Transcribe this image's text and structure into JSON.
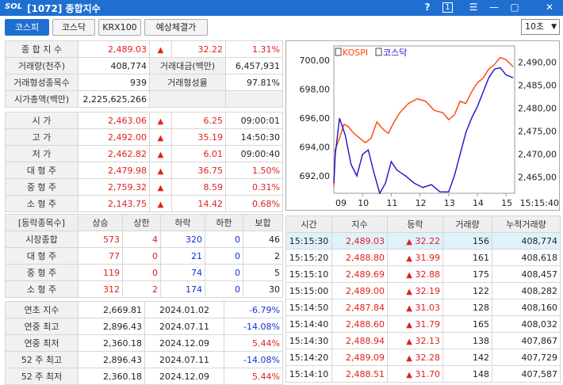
{
  "window": {
    "logo": "SOL",
    "title": "[1072] 종합지수",
    "help": "?",
    "page": "1"
  },
  "tabs": [
    "코스피",
    "코스닥",
    "KRX100",
    "예상체결가"
  ],
  "interval": "10초",
  "summary": {
    "index_label": "종 합 지 수",
    "index_value": "2,489.03",
    "index_change": "32.22",
    "index_pct": "1.31%",
    "volume_label": "거래량(천주)",
    "volume_value": "408,774",
    "amount_label": "거래대금(백만)",
    "amount_value": "6,457,931",
    "traded_count_label": "거래형성종목수",
    "traded_count_value": "939",
    "traded_ratio_label": "거래형성율",
    "traded_ratio_value": "97.81%",
    "market_cap_label": "시가총액(백만)",
    "market_cap_value": "2,225,625,266"
  },
  "detail": [
    {
      "label": "시    가",
      "value": "2,463.06",
      "change": "6.25",
      "extra": "09:00:01"
    },
    {
      "label": "고    가",
      "value": "2,492.00",
      "change": "35.19",
      "extra": "14:50:30"
    },
    {
      "label": "저    가",
      "value": "2,462.82",
      "change": "6.01",
      "extra": "09:00:40"
    },
    {
      "label": "대 형 주",
      "value": "2,479.98",
      "change": "36.75",
      "extra": "1.50%"
    },
    {
      "label": "중 형 주",
      "value": "2,759.32",
      "change": "8.59",
      "extra": "0.31%"
    },
    {
      "label": "소 형 주",
      "value": "2,143.75",
      "change": "14.42",
      "extra": "0.68%"
    }
  ],
  "updown": {
    "headers": [
      "[등락종목수]",
      "상승",
      "상한",
      "하락",
      "하한",
      "보합"
    ],
    "rows": [
      {
        "label": "시장종합",
        "up": "573",
        "upper": "4",
        "down": "320",
        "lower": "0",
        "flat": "46"
      },
      {
        "label": "대 형 주",
        "up": "77",
        "upper": "0",
        "down": "21",
        "lower": "0",
        "flat": "2"
      },
      {
        "label": "중 형 주",
        "up": "119",
        "upper": "0",
        "down": "74",
        "lower": "0",
        "flat": "5"
      },
      {
        "label": "소 형 주",
        "up": "312",
        "upper": "2",
        "down": "174",
        "lower": "0",
        "flat": "30"
      }
    ]
  },
  "yearly": [
    {
      "label": "연초  지수",
      "value": "2,669.81",
      "date": "2024.01.02",
      "pct": "-6.79%"
    },
    {
      "label": "연중  최고",
      "value": "2,896.43",
      "date": "2024.07.11",
      "pct": "-14.08%"
    },
    {
      "label": "연중  최저",
      "value": "2,360.18",
      "date": "2024.12.09",
      "pct": "5.44%"
    },
    {
      "label": "52 주 최고",
      "value": "2,896.43",
      "date": "2024.07.11",
      "pct": "-14.08%"
    },
    {
      "label": "52 주 최저",
      "value": "2,360.18",
      "date": "2024.12.09",
      "pct": "5.44%"
    }
  ],
  "ticks": {
    "headers": [
      "시간",
      "지수",
      "등락",
      "거래량",
      "누적거래량"
    ],
    "rows": [
      {
        "time": "15:15:30",
        "index": "2,489.03",
        "change": "32.22",
        "volume": "156",
        "cum": "408,774"
      },
      {
        "time": "15:15:20",
        "index": "2,488.80",
        "change": "31.99",
        "volume": "161",
        "cum": "408,618"
      },
      {
        "time": "15:15:10",
        "index": "2,489.69",
        "change": "32.88",
        "volume": "175",
        "cum": "408,457"
      },
      {
        "time": "15:15:00",
        "index": "2,489.00",
        "change": "32.19",
        "volume": "122",
        "cum": "408,282"
      },
      {
        "time": "15:14:50",
        "index": "2,487.84",
        "change": "31.03",
        "volume": "128",
        "cum": "408,160"
      },
      {
        "time": "15:14:40",
        "index": "2,488.60",
        "change": "31.79",
        "volume": "165",
        "cum": "408,032"
      },
      {
        "time": "15:14:30",
        "index": "2,488.94",
        "change": "32.13",
        "volume": "138",
        "cum": "407,867"
      },
      {
        "time": "15:14:20",
        "index": "2,489.09",
        "change": "32.28",
        "volume": "142",
        "cum": "407,729"
      },
      {
        "time": "15:14:10",
        "index": "2,488.51",
        "change": "31.70",
        "volume": "148",
        "cum": "407,587"
      }
    ]
  },
  "chart_data": {
    "type": "line",
    "legend": [
      "KOSPI",
      "코스닥"
    ],
    "x_ticks": [
      "09",
      "10",
      "11",
      "12",
      "13",
      "14",
      "15",
      "15:15:40"
    ],
    "y_left_ticks": [
      "700,00",
      "698,00",
      "696,00",
      "694,00",
      "692,00"
    ],
    "y_right_ticks": [
      "2,490,00",
      "2,485,00",
      "2,480,00",
      "2,475,00",
      "2,470,00",
      "2,465,00"
    ],
    "y_left_range": [
      690.8,
      701.0
    ],
    "y_right_range": [
      2461.5,
      2493.5
    ],
    "series": [
      {
        "name": "KOSPI",
        "color": "#ff4400",
        "axis": "right",
        "t": [
          9.0,
          9.05,
          9.2,
          9.35,
          9.5,
          9.7,
          9.9,
          10.1,
          10.3,
          10.5,
          10.7,
          10.9,
          11.1,
          11.3,
          11.6,
          11.9,
          12.2,
          12.5,
          12.8,
          13.0,
          13.2,
          13.4,
          13.6,
          13.8,
          14.0,
          14.2,
          14.4,
          14.6,
          14.8,
          15.0,
          15.25
        ],
        "v": [
          2463.0,
          2471.0,
          2473.5,
          2476.5,
          2476.0,
          2474.5,
          2473.5,
          2472.5,
          2473.5,
          2477.0,
          2475.5,
          2474.5,
          2477.0,
          2479.0,
          2481.0,
          2482.0,
          2481.5,
          2479.5,
          2479.0,
          2477.5,
          2478.5,
          2481.5,
          2481.0,
          2483.5,
          2485.5,
          2486.5,
          2488.5,
          2489.5,
          2491.0,
          2490.5,
          2489.0
        ]
      },
      {
        "name": "코스닥",
        "color": "#2010c8",
        "axis": "left",
        "t": [
          9.0,
          9.05,
          9.2,
          9.4,
          9.6,
          9.8,
          10.0,
          10.2,
          10.4,
          10.6,
          10.8,
          11.0,
          11.2,
          11.5,
          11.8,
          12.1,
          12.4,
          12.7,
          13.0,
          13.2,
          13.4,
          13.6,
          13.8,
          14.0,
          14.2,
          14.4,
          14.6,
          14.8,
          15.0,
          15.25
        ],
        "v": [
          691.5,
          693.5,
          696.0,
          694.8,
          692.8,
          692.0,
          693.5,
          693.8,
          692.2,
          690.8,
          691.5,
          693.0,
          692.4,
          692.0,
          691.5,
          691.2,
          691.4,
          690.9,
          690.9,
          692.0,
          693.5,
          695.0,
          696.0,
          696.8,
          697.8,
          698.8,
          699.4,
          699.5,
          699.0,
          698.8
        ]
      }
    ]
  }
}
